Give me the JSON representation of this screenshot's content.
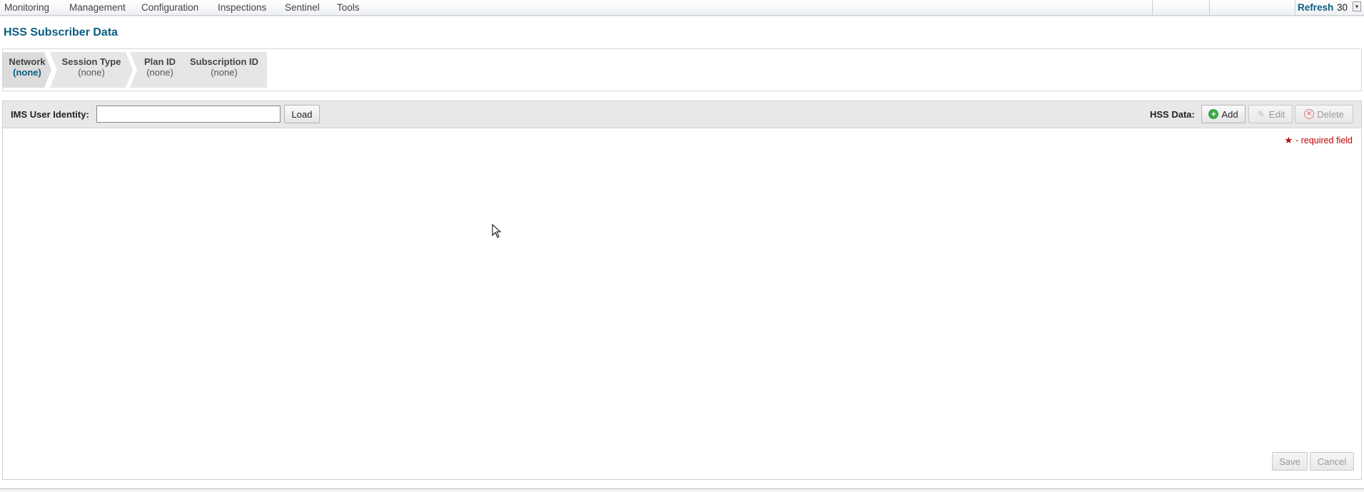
{
  "menubar": {
    "items": [
      {
        "label": "Monitoring"
      },
      {
        "label": "Management"
      },
      {
        "label": "Configuration"
      },
      {
        "label": "Inspections"
      },
      {
        "label": "Sentinel"
      },
      {
        "label": "Tools"
      }
    ],
    "refresh_label": "Refresh",
    "refresh_value": "30"
  },
  "page": {
    "title": "HSS Subscriber Data"
  },
  "breadcrumb": {
    "items": [
      {
        "label": "Network",
        "value": "(none)"
      },
      {
        "label": "Session Type",
        "value": "(none)"
      },
      {
        "label": "Plan ID",
        "value": "(none)"
      },
      {
        "label": "Subscription ID",
        "value": "(none)"
      }
    ]
  },
  "toolbar": {
    "ims_label": "IMS User Identity:",
    "ims_value": "",
    "load_label": "Load",
    "hss_label": "HSS Data:",
    "add_label": "Add",
    "edit_label": "Edit",
    "delete_label": "Delete"
  },
  "form": {
    "required_note": "- required field",
    "save_label": "Save",
    "cancel_label": "Cancel"
  },
  "icons": {
    "add": "plus-circle-icon",
    "edit": "pencil-icon",
    "delete": "x-circle-icon",
    "required": "star-icon"
  },
  "colors": {
    "accent": "#0b5d80",
    "required": "#c00000",
    "add_icon": "#3aa54a"
  }
}
